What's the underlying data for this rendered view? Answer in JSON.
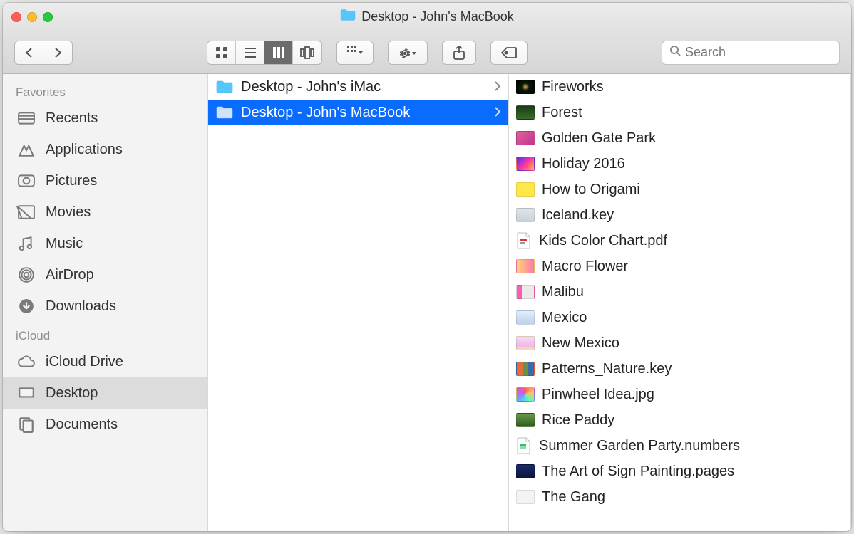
{
  "window": {
    "title": "Desktop - John's MacBook"
  },
  "toolbar": {
    "view_modes": [
      "icon",
      "list",
      "column",
      "gallery"
    ],
    "active_view_index": 2
  },
  "search": {
    "placeholder": "Search",
    "value": ""
  },
  "sidebar": {
    "sections": [
      {
        "label": "Favorites",
        "items": [
          {
            "icon": "recents",
            "label": "Recents"
          },
          {
            "icon": "applications",
            "label": "Applications"
          },
          {
            "icon": "pictures",
            "label": "Pictures"
          },
          {
            "icon": "movies",
            "label": "Movies"
          },
          {
            "icon": "music",
            "label": "Music"
          },
          {
            "icon": "airdrop",
            "label": "AirDrop"
          },
          {
            "icon": "downloads",
            "label": "Downloads"
          }
        ]
      },
      {
        "label": "iCloud",
        "items": [
          {
            "icon": "icloud",
            "label": "iCloud Drive"
          },
          {
            "icon": "desktop",
            "label": "Desktop",
            "selected": true
          },
          {
            "icon": "documents",
            "label": "Documents"
          }
        ]
      }
    ]
  },
  "columns": [
    {
      "items": [
        {
          "kind": "folder",
          "label": "Desktop - John's iMac",
          "has_children": true
        },
        {
          "kind": "folder",
          "label": "Desktop - John's MacBook",
          "has_children": true,
          "selected": true
        }
      ]
    },
    {
      "items": [
        {
          "kind": "image",
          "label": "Fireworks",
          "thumb_css": "radial-gradient(circle at 50% 50%, #f0a050 0%, #071b07 35%, #000 100%)"
        },
        {
          "kind": "image",
          "label": "Forest",
          "thumb_css": "linear-gradient(#1b3d15, #3a6a2a)"
        },
        {
          "kind": "image",
          "label": "Golden Gate Park",
          "thumb_css": "linear-gradient(135deg, #e0609a 0%, #c1358f 100%)"
        },
        {
          "kind": "image",
          "label": "Holiday 2016",
          "thumb_css": "linear-gradient(135deg, #2e3cff 0%, #ff2ea8 50%, #ffc22e 100%)"
        },
        {
          "kind": "image",
          "label": "How to Origami",
          "thumb_css": "linear-gradient(#ffe74a, #ffe74a)"
        },
        {
          "kind": "keynote",
          "label": "Iceland.key",
          "thumb_css": "linear-gradient(#dfe6ea, #c7d2d8)"
        },
        {
          "kind": "pdf",
          "label": "Kids Color Chart.pdf",
          "thumb_css": "#ffffff"
        },
        {
          "kind": "image",
          "label": "Macro Flower",
          "thumb_css": "linear-gradient(90deg, #ffd27a, #ff7aa8)"
        },
        {
          "kind": "image",
          "label": "Malibu",
          "thumb_css": "linear-gradient(90deg, #ff5db1 30%, #eaeaea 30%)"
        },
        {
          "kind": "image",
          "label": "Mexico",
          "thumb_css": "linear-gradient(#dfefff, #bcd2e6)"
        },
        {
          "kind": "image",
          "label": "New Mexico",
          "thumb_css": "linear-gradient(#f6d9ff, #f2b8e6 70%, #f2e0b8)"
        },
        {
          "kind": "keynote",
          "label": "Patterns_Nature.key",
          "thumb_css": "linear-gradient(90deg, #e46d3c 33%, #6a8f4a 33% 66%, #3c6aa6 66%)"
        },
        {
          "kind": "image",
          "label": "Pinwheel Idea.jpg",
          "thumb_css": "conic-gradient(#ff5e5e, #ffc25e, #5effb1, #5eb9ff, #c15eff, #ff5e5e)"
        },
        {
          "kind": "image",
          "label": "Rice Paddy",
          "thumb_css": "linear-gradient(#6a9a4a, #2f5a22)"
        },
        {
          "kind": "numbers",
          "label": "Summer Garden Party.numbers",
          "thumb_css": "#ffffff"
        },
        {
          "kind": "pages",
          "label": "The Art of Sign Painting.pages",
          "thumb_css": "linear-gradient(#1b2a6a, #0c1540)"
        },
        {
          "kind": "image",
          "label": "The Gang",
          "thumb_css": "#f3f3f3"
        }
      ]
    }
  ]
}
